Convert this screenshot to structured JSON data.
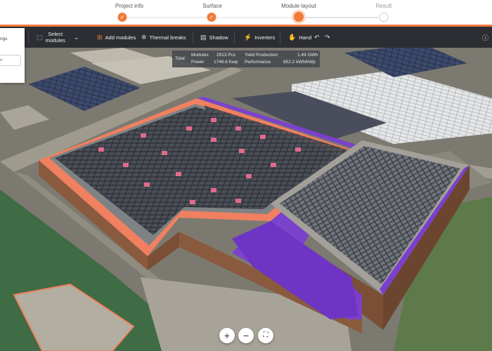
{
  "stepper": {
    "steps": [
      {
        "label": "Project info",
        "state": "done"
      },
      {
        "label": "Surface",
        "state": "done"
      },
      {
        "label": "Module layout",
        "state": "active"
      },
      {
        "label": "Result",
        "state": "todo"
      }
    ],
    "check_glyph": "✓"
  },
  "toolbar": {
    "select_modules_line1": "Select",
    "select_modules_line2": "modules",
    "add_modules": "Add modules",
    "thermal_breaks": "Thermal breaks",
    "shadow": "Shadow",
    "inverters": "Inverters",
    "hand": "Hand",
    "icons": {
      "select": "⬚",
      "chevron": "⌄",
      "add": "⊞",
      "thermal": "✲",
      "shadow": "▤",
      "inverters": "⚡",
      "hand": "✋",
      "undo": "↶",
      "redo": "↷",
      "info": "ⓘ"
    }
  },
  "settings_panel": {
    "label": "ngs",
    "input_value": "e"
  },
  "stats": {
    "total_label": "Total:",
    "modules_label": "Modules",
    "modules_value": "2913 Pcs",
    "power_label": "Power",
    "power_value": "1748.6 Kwp",
    "yield_label": "Yield Production",
    "yield_value": "1.49 GWh",
    "performance_label": "Performance",
    "performance_value": "852.2 kWh/kWp"
  },
  "zoom": {
    "zoom_in": "+",
    "zoom_out": "−",
    "view_icon": "⛶"
  },
  "colors": {
    "accent": "#f07a3a",
    "toolbar_bg": "#2c2e33",
    "roof_edge": "#f08060",
    "purple_zone": "#7b3fd0",
    "panel": "#3a3d42",
    "wall": "#8a5a3e"
  }
}
